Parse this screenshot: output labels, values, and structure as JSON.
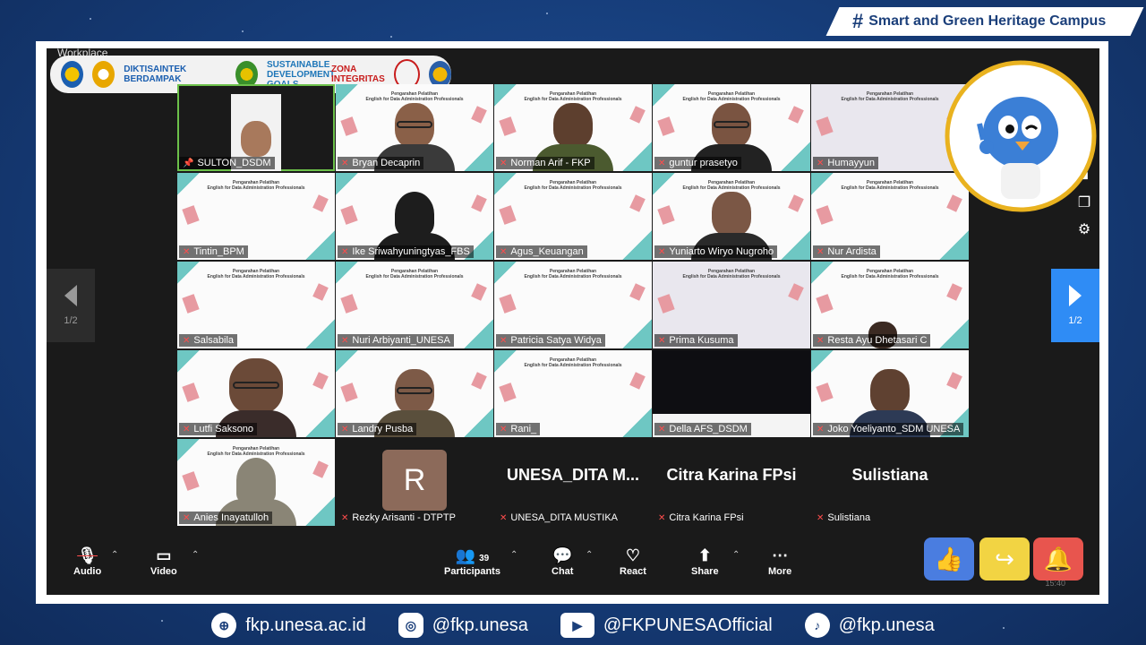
{
  "banner": {
    "hashtag": "#",
    "text": "Smart and Green Heritage Campus"
  },
  "window": {
    "title": "Workplace"
  },
  "logos": [
    "DIKTISAINTEK BERDAMPAK",
    "SUSTAINABLE DEVELOPMENT GOALS",
    "ZONA INTEGRITAS"
  ],
  "slide": {
    "heading": "Pengarahan Pelatihan",
    "subheading": "English for Data Administration Professionals"
  },
  "participants": [
    {
      "name": "SULTON_DSDM",
      "pinned": true,
      "muted": false,
      "kind": "video"
    },
    {
      "name": "Bryan Decaprin",
      "muted": true,
      "kind": "slide-video"
    },
    {
      "name": "Norman Arif - FKP",
      "muted": true,
      "kind": "slide-video"
    },
    {
      "name": "guntur prasetyo",
      "muted": true,
      "kind": "slide-video"
    },
    {
      "name": "Humayyun",
      "muted": true,
      "kind": "slide"
    },
    {
      "name": "Tintin_BPM",
      "muted": true,
      "kind": "slide"
    },
    {
      "name": "Ike Sriwahyuningtyas_FBS",
      "muted": true,
      "kind": "slide-video"
    },
    {
      "name": "Agus_Keuangan",
      "muted": true,
      "kind": "slide"
    },
    {
      "name": "Yuniarto Wiryo Nugroho",
      "muted": true,
      "kind": "slide-video"
    },
    {
      "name": "Nur Ardista",
      "muted": true,
      "kind": "slide"
    },
    {
      "name": "Salsabila",
      "muted": true,
      "kind": "slide"
    },
    {
      "name": "Nuri Arbiyanti_UNESA",
      "muted": true,
      "kind": "slide"
    },
    {
      "name": "Patricia Satya Widya",
      "muted": true,
      "kind": "slide"
    },
    {
      "name": "Prima Kusuma",
      "muted": true,
      "kind": "slide"
    },
    {
      "name": "Resta Ayu Dhetasari C",
      "muted": true,
      "kind": "slide-video"
    },
    {
      "name": "Lutfi Saksono",
      "muted": true,
      "kind": "slide-video"
    },
    {
      "name": "Landry Pusba",
      "muted": true,
      "kind": "slide-video"
    },
    {
      "name": "Rani_",
      "muted": true,
      "kind": "slide"
    },
    {
      "name": "Della AFS_DSDM",
      "muted": true,
      "kind": "dark"
    },
    {
      "name": "Joko Yoeliyanto_SDM UNESA",
      "muted": true,
      "kind": "slide-video"
    },
    {
      "name": "Anies Inayatulloh",
      "muted": true,
      "kind": "slide-video"
    },
    {
      "name": "Rezky Arisanti - DTPTP",
      "muted": true,
      "kind": "avatar",
      "initial": "R"
    },
    {
      "name": "UNESA_DITA MUSTIKA",
      "muted": true,
      "kind": "name",
      "display": "UNESA_DITA  M..."
    },
    {
      "name": "Citra Karina FPsi",
      "muted": true,
      "kind": "name",
      "display": "Citra Karina FPsi"
    },
    {
      "name": "Sulistiana",
      "muted": true,
      "kind": "name",
      "display": "Sulistiana"
    }
  ],
  "pager": {
    "left": "1/2",
    "right": "1/2"
  },
  "toolbar": {
    "audio": "Audio",
    "video": "Video",
    "participants": "Participants",
    "participants_count": "39",
    "chat": "Chat",
    "react": "React",
    "share": "Share",
    "more": "More",
    "time": "15:40"
  },
  "reactions": [
    "thumbs-up",
    "raise-hand",
    "alarm"
  ],
  "social": {
    "web": "fkp.unesa.ac.id",
    "instagram": "@fkp.unesa",
    "youtube": "@FKPUNESAOfficial",
    "tiktok": "@fkp.unesa"
  }
}
